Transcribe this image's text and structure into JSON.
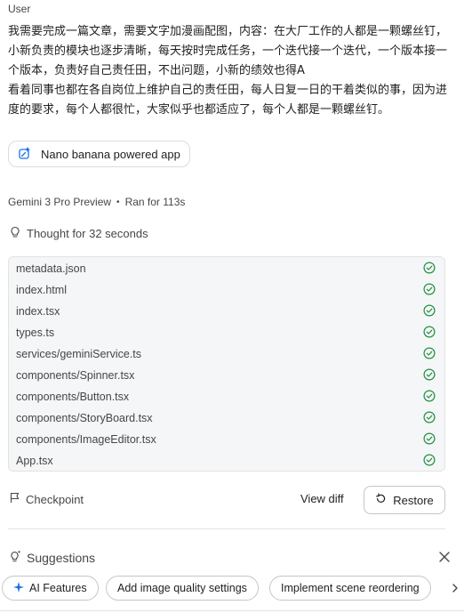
{
  "message": {
    "role": "User",
    "text": "我需要完成一篇文章，需要文字加漫画配图，内容：在大厂工作的人都是一颗螺丝钉，小新负责的模块也逐步清晰，每天按时完成任务，一个迭代接一个迭代，一个版本接一个版本，负责好自己责任田，不出问题，小新的绩效也得A\n看着同事也都在各自岗位上维护自己的责任田，每人日复一日的干着类似的事，因为进度的要求，每个人都很忙，大家似乎也都适应了，每个人都是一颗螺丝钉。"
  },
  "app_chip": {
    "label": "Nano banana powered app",
    "icon": "sparkle-edit-icon"
  },
  "run": {
    "model": "Gemini 3 Pro Preview",
    "separator": "•",
    "duration": "Ran for 113s"
  },
  "thought": {
    "label": "Thought for 32 seconds",
    "icon": "lightbulb-icon"
  },
  "files": [
    "metadata.json",
    "index.html",
    "index.tsx",
    "types.ts",
    "services/geminiService.ts",
    "components/Spinner.tsx",
    "components/Button.tsx",
    "components/StoryBoard.tsx",
    "components/ImageEditor.tsx",
    "App.tsx"
  ],
  "colors": {
    "check": "#1e8e3e",
    "accent": "#1a73e8",
    "border": "#c4c7c5"
  },
  "checkpoint": {
    "label": "Checkpoint",
    "icon": "flag-icon"
  },
  "actions": {
    "view_diff": "View diff",
    "restore": "Restore"
  },
  "suggestions": {
    "title": "Suggestions",
    "items": [
      {
        "label": "AI Features",
        "icon": "sparkle-icon"
      },
      {
        "label": "Add image quality settings"
      },
      {
        "label": "Implement scene reordering"
      }
    ]
  }
}
